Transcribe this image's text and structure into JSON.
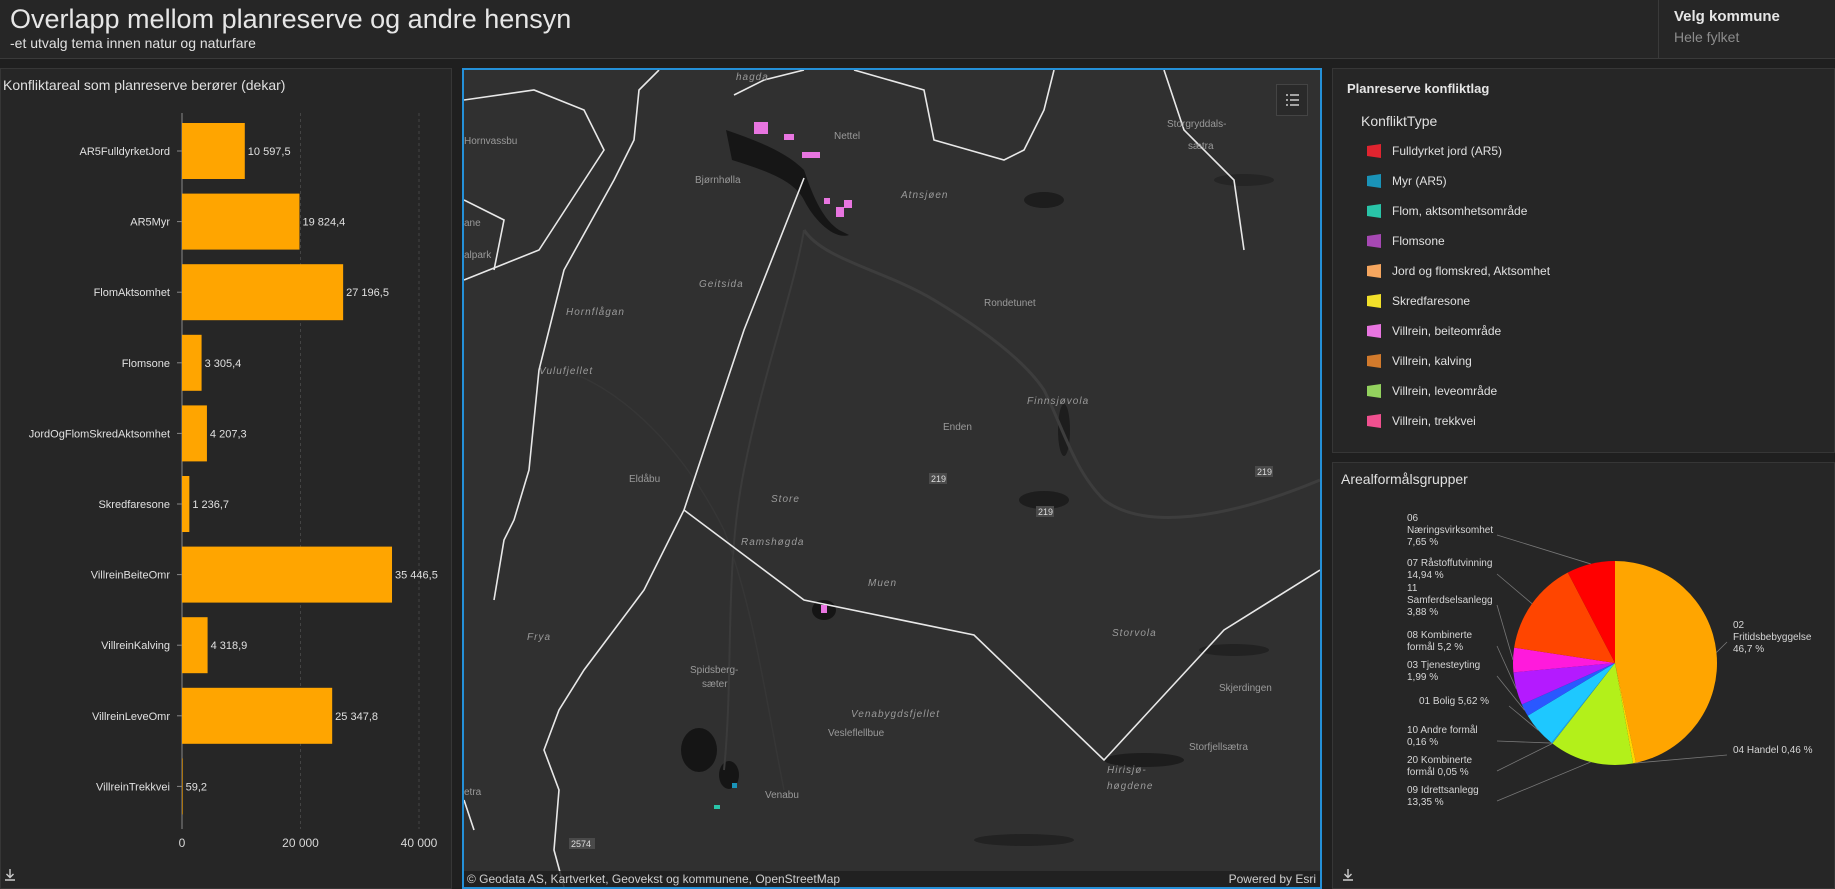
{
  "header": {
    "title": "Overlapp mellom planreserve og andre hensyn",
    "subtitle": "-et utvalg tema innen natur og naturfare",
    "selector_label": "Velg kommune",
    "selector_value": "Hele fylket"
  },
  "bar_panel": {
    "title": "Konfliktareal som planreserve berører (dekar)",
    "download_icon": "download-icon"
  },
  "map": {
    "attribution": "© Geodata AS, Kartverket, Geovekst og kommunene, OpenStreetMap",
    "powered_by": "Powered by Esri",
    "legend_toggle_icon": "list-icon",
    "labels": [
      "hagda",
      "Nettel",
      "Atnsjøen",
      "Bjørnhølla",
      "Storgryddals-",
      "sætra",
      "Geitsida",
      "Hornflågan",
      "Rondetunet",
      "Vulufjellet",
      "Finnsjøvola",
      "Enden",
      "Eldåbu",
      "Store",
      "Ramshøgda",
      "Muen",
      "Storvola",
      "Skjerdingen",
      "Spidsberg-",
      "sæter",
      "Venabygdsfjellet",
      "Vesleflellbue",
      "Storfjellsætra",
      "Hirisjø-",
      "høgdene",
      "Venabu",
      "Frya",
      "Hornvassbu",
      "ane",
      "alpark",
      "etra"
    ],
    "road_labels": [
      "219",
      "219",
      "219",
      "2574"
    ]
  },
  "legend": {
    "title": "Planreserve konfliktlag",
    "field": "KonfliktType",
    "items": [
      {
        "label": "Fulldyrket jord (AR5)",
        "color": "#e0242f"
      },
      {
        "label": "Myr (AR5)",
        "color": "#1a93b8"
      },
      {
        "label": "Flom, aktsomhetsområde",
        "color": "#29c4a8"
      },
      {
        "label": "Flomsone",
        "color": "#a648b3"
      },
      {
        "label": "Jord og flomskred, Aktsomhet",
        "color": "#f5a65f"
      },
      {
        "label": "Skredfaresone",
        "color": "#f2e02a"
      },
      {
        "label": "Villrein, beiteområde",
        "color": "#e875e0"
      },
      {
        "label": "Villrein, kalving",
        "color": "#d17a2c"
      },
      {
        "label": "Villrein, leveområde",
        "color": "#93d15e"
      },
      {
        "label": "Villrein, trekkvei",
        "color": "#f0508f"
      }
    ]
  },
  "pie_panel": {
    "title": "Arealformålsgrupper",
    "download_icon": "download-icon"
  },
  "chart_data": [
    {
      "type": "bar",
      "orientation": "horizontal",
      "title": "Konfliktareal som planreserve berører (dekar)",
      "categories": [
        "AR5FulldyrketJord",
        "AR5Myr",
        "FlomAktsomhet",
        "Flomsone",
        "JordOgFlomSkredAktsomhet",
        "Skredfaresone",
        "VillreinBeiteOmr",
        "VillreinKalving",
        "VillreinLeveOmr",
        "VillreinTrekkvei"
      ],
      "values": [
        10597.5,
        19824.4,
        27196.5,
        3305.4,
        4207.3,
        1236.7,
        35446.5,
        4318.9,
        25347.8,
        59.2
      ],
      "value_labels": [
        "10 597,5",
        "19 824,4",
        "27 196,5",
        "3 305,4",
        "4 207,3",
        "1 236,7",
        "35 446,5",
        "4 318,9",
        "25 347,8",
        "59,2"
      ],
      "xlim": [
        0,
        40000
      ],
      "xticks": [
        0,
        20000,
        40000
      ],
      "xtick_labels": [
        "0",
        "20 000",
        "40 000"
      ],
      "bar_color": "#ffa500",
      "grid": true
    },
    {
      "type": "pie",
      "title": "Arealformålsgrupper",
      "slices": [
        {
          "name": "02 Fritidsbebyggelse",
          "value": 46.7,
          "label_lines": [
            "02",
            "Fritidsbebyggelse",
            "46,7 %"
          ],
          "color": "#ffa500"
        },
        {
          "name": "04 Handel",
          "value": 0.46,
          "label_lines": [
            "04 Handel 0,46 %"
          ],
          "color": "#ffd700"
        },
        {
          "name": "09 Idrettsanlegg",
          "value": 13.35,
          "label_lines": [
            "09 Idrettsanlegg",
            "13,35 %"
          ],
          "color": "#b3f01a"
        },
        {
          "name": "20 Kombinerte formål",
          "value": 0.05,
          "label_lines": [
            "20 Kombinerte",
            "formål 0,05 %"
          ],
          "color": "#66e07a"
        },
        {
          "name": "10 Andre formål",
          "value": 0.16,
          "label_lines": [
            "10 Andre formål",
            "0,16 %"
          ],
          "color": "#1aa8ff"
        },
        {
          "name": "01 Bolig",
          "value": 5.62,
          "label_lines": [
            "01 Bolig 5,62 %"
          ],
          "color": "#1ec8ff"
        },
        {
          "name": "03 Tjenesteyting",
          "value": 1.99,
          "label_lines": [
            "03 Tjenesteyting",
            "1,99 %"
          ],
          "color": "#2a58ff"
        },
        {
          "name": "08 Kombinerte formål",
          "value": 5.2,
          "label_lines": [
            "08 Kombinerte",
            "formål 5,2 %"
          ],
          "color": "#b41aff"
        },
        {
          "name": "11 Samferdselsanlegg",
          "value": 3.88,
          "label_lines": [
            "11",
            "Samferdselsanlegg",
            "3,88 %"
          ],
          "color": "#ff1adc"
        },
        {
          "name": "07 Råstoffutvinning",
          "value": 14.94,
          "label_lines": [
            "07 Råstoffutvinning",
            "14,94 %"
          ],
          "color": "#ff4500"
        },
        {
          "name": "06 Næringsvirksomhet",
          "value": 7.65,
          "label_lines": [
            "06",
            "Næringsvirksomhet",
            "7,65 %"
          ],
          "color": "#ff0000"
        }
      ]
    }
  ]
}
